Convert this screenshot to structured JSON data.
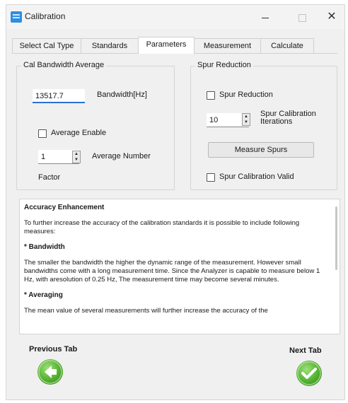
{
  "window": {
    "title": "Calibration"
  },
  "titlebar": {
    "minimize": "—",
    "close": "✕"
  },
  "tabs": [
    {
      "label": "Select Cal Type"
    },
    {
      "label": "Standards"
    },
    {
      "label": "Parameters",
      "active": true
    },
    {
      "label": "Measurement"
    },
    {
      "label": "Calculate"
    }
  ],
  "cal_bandwidth": {
    "group_title": "Cal Bandwidth  Average",
    "bandwidth_value": "13517.7",
    "bandwidth_label": "Bandwidth[Hz]",
    "average_enable_label": "Average Enable",
    "average_enable_checked": false,
    "average_number_value": "1",
    "average_number_label": "Average Number",
    "factor_label": "Factor"
  },
  "spur_reduction": {
    "group_title": "Spur Reduction",
    "spur_reduction_label": "Spur Reduction",
    "spur_reduction_checked": false,
    "iterations_value": "10",
    "iterations_label_line1": "Spur Calibration",
    "iterations_label_line2": "Iterations",
    "measure_button": "Measure Spurs",
    "valid_label": "Spur Calibration Valid",
    "valid_checked": false
  },
  "info": {
    "heading": "Accuracy Enhancement",
    "intro": "To further increase the accuracy of the calibration standards it is possible to include following measures:",
    "bandwidth_heading": "* Bandwidth",
    "bandwidth_text": "The smaller the bandwidth the higher the dynamic range of the measurement. However small bandwidths come with a long measurement time. Since the Analyzer is capable to measure below 1 Hz, with aresolution of 0.25 Hz, The measurement time may become several minutes.",
    "averaging_heading": "* Averaging",
    "averaging_text": "The mean value of several measurements will further increase the accuracy of the"
  },
  "nav": {
    "previous_label": "Previous Tab",
    "next_label": "Next Tab"
  },
  "colors": {
    "accent": "#2d6ed3",
    "nav_green": "#4fae2d"
  }
}
